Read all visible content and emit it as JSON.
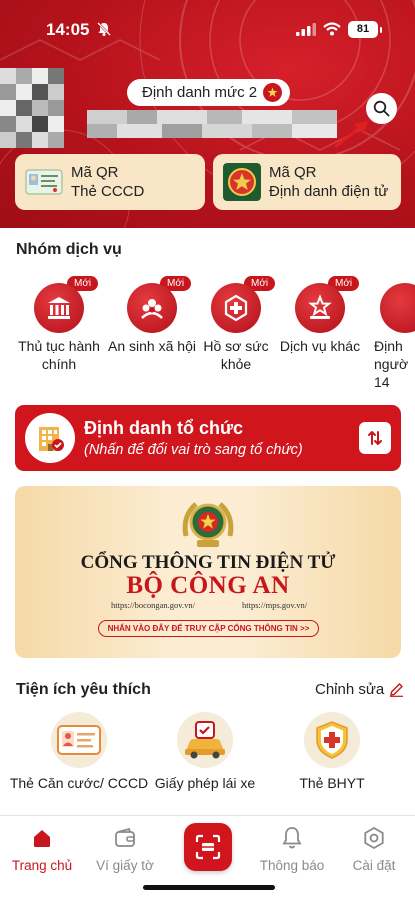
{
  "status_bar": {
    "time": "14:05",
    "battery": "81"
  },
  "header": {
    "level_label": "Định danh mức 2",
    "qr_cards": [
      {
        "line1": "Mã QR",
        "line2": "Thẻ CCCD"
      },
      {
        "line1": "Mã QR",
        "line2": "Định danh điện tử"
      }
    ]
  },
  "services": {
    "title": "Nhóm dịch vụ",
    "badge": "Mới",
    "items": [
      {
        "label": "Thủ tục hành chính",
        "icon": "government-building-icon"
      },
      {
        "label": "An sinh xã hội",
        "icon": "social-care-icon"
      },
      {
        "label": "Hồ sơ sức khỏe",
        "icon": "health-record-icon"
      },
      {
        "label": "Dịch vụ khác",
        "icon": "star-podium-icon"
      },
      {
        "label": "Định ngườ 14",
        "icon": "identity-icon"
      }
    ]
  },
  "org_banner": {
    "title": "Định danh tổ chức",
    "subtitle": "(Nhấn để đổi vai trò sang tổ chức)"
  },
  "portal": {
    "line1": "CỔNG THÔNG TIN ĐIỆN TỬ",
    "line2": "BỘ CÔNG AN",
    "url1": "https://bocongan.gov.vn/",
    "url2": "https://mps.gov.vn/",
    "cta": "NHẤN VÀO ĐÂY ĐỂ TRUY CẬP CỔNG THÔNG TIN >>"
  },
  "favorites": {
    "title": "Tiện ích yêu thích",
    "edit": "Chỉnh sửa",
    "items": [
      {
        "label": "Thẻ Căn cước/ CCCD",
        "icon": "id-card-icon"
      },
      {
        "label": "Giấy phép lái xe",
        "icon": "driving-license-icon"
      },
      {
        "label": "Thẻ BHYT",
        "icon": "health-insurance-icon"
      }
    ]
  },
  "bottom_nav": {
    "items": [
      {
        "label": "Trang chủ",
        "icon": "home-icon"
      },
      {
        "label": "Ví giấy tờ",
        "icon": "wallet-icon"
      },
      {
        "label": "Thông báo",
        "icon": "bell-icon"
      },
      {
        "label": "Cài đặt",
        "icon": "gear-icon"
      }
    ]
  },
  "colors": {
    "primary_red": "#c8161d",
    "card_beige": "#f8e6c6"
  }
}
